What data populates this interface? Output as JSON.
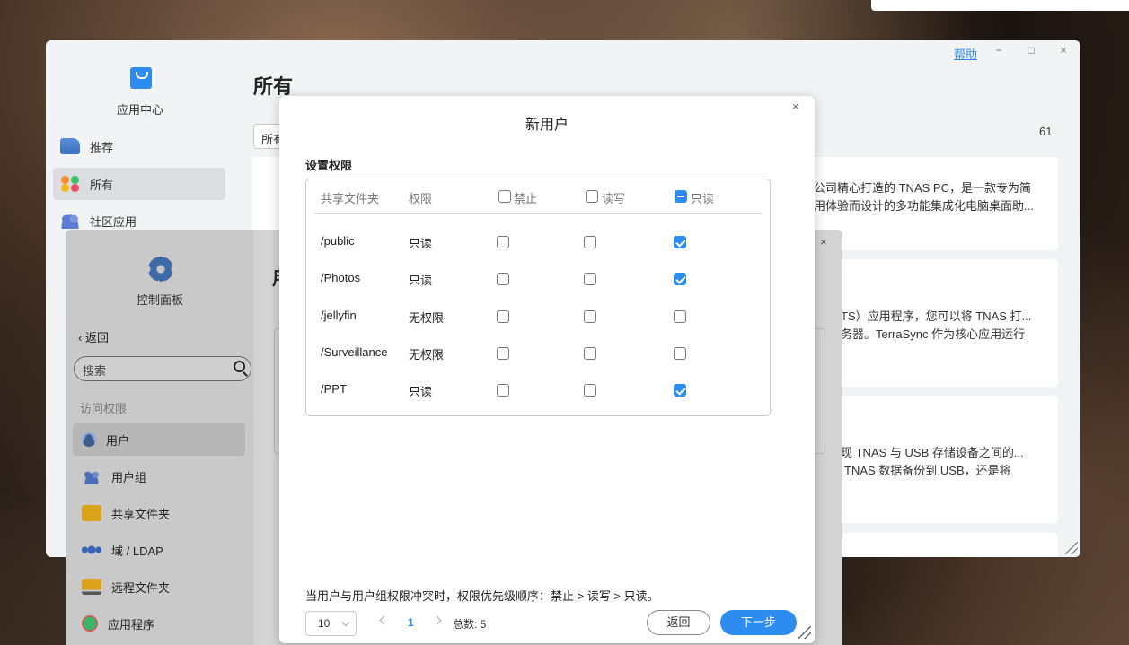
{
  "app_center": {
    "title": "应用中心",
    "nav": [
      {
        "label": "推荐",
        "icon": "thumbs-up-icon"
      },
      {
        "label": "所有",
        "icon": "apps-grid-icon"
      },
      {
        "label": "社区应用",
        "icon": "community-icon"
      }
    ],
    "main_title": "所有",
    "filter_value": "所有",
    "count": "61",
    "help": "帮助",
    "cards": [
      {
        "line1": "公司精心打造的 TNAS PC，是一款专为简",
        "line2": "用体验而设计的多功能集成化电脑桌面助..."
      },
      {
        "line1": "TS）应用程序，您可以将 TNAS 打...",
        "line2": "务器。TerraSync 作为核心应用运行"
      },
      {
        "line1": "现 TNAS 与 USB 存储设备之间的...",
        "line2": "TNAS 数据备份到 USB，还是将"
      }
    ]
  },
  "control_panel": {
    "title": "控制面板",
    "back": "返回",
    "search_placeholder": "搜索",
    "section": "访问权限",
    "nav": [
      {
        "label": "用户",
        "icon": "user-icon"
      },
      {
        "label": "用户组",
        "icon": "user-group-icon"
      },
      {
        "label": "共享文件夹",
        "icon": "folder-icon"
      },
      {
        "label": "域 / LDAP",
        "icon": "ldap-icon"
      },
      {
        "label": "远程文件夹",
        "icon": "remote-folder-icon"
      },
      {
        "label": "应用程序",
        "icon": "apps-icon"
      }
    ],
    "heading_fragment": "用"
  },
  "modal": {
    "title": "新用户",
    "section_label": "设置权限",
    "columns": {
      "folder": "共享文件夹",
      "permission": "权限",
      "deny": "禁止",
      "read_write": "读写",
      "read_only": "只读"
    },
    "rows": [
      {
        "folder": "/public",
        "permission": "只读",
        "deny": false,
        "read_write": false,
        "read_only": true
      },
      {
        "folder": "/Photos",
        "permission": "只读",
        "deny": false,
        "read_write": false,
        "read_only": true
      },
      {
        "folder": "/jellyfin",
        "permission": "无权限",
        "deny": false,
        "read_write": false,
        "read_only": false
      },
      {
        "folder": "/Surveillance",
        "permission": "无权限",
        "deny": false,
        "read_write": false,
        "read_only": false
      },
      {
        "folder": "/PPT",
        "permission": "只读",
        "deny": false,
        "read_write": false,
        "read_only": true
      }
    ],
    "footer_note": "当用户与用户组权限冲突时，权限优先级顺序：禁止 > 读写 > 只读。",
    "page_size": "10",
    "current_page": "1",
    "total": "总数: 5",
    "back_button": "返回",
    "next_button": "下一步"
  },
  "colors": {
    "accent": "#2d8cf0"
  }
}
